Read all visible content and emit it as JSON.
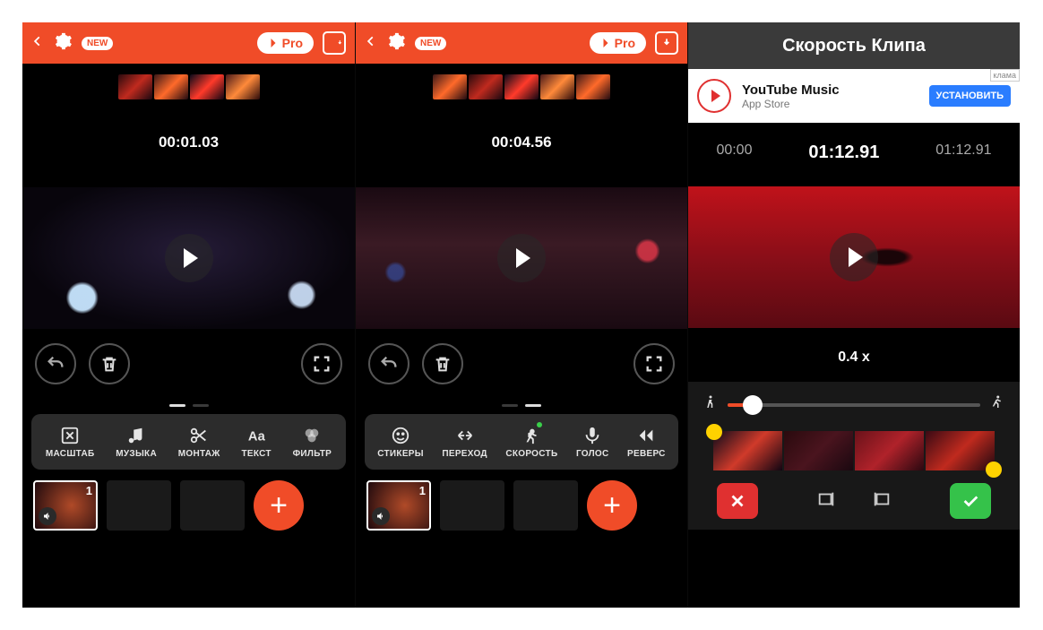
{
  "panel1": {
    "new_badge": "NEW",
    "pro_label": "Pro",
    "timecode": "00:01.03",
    "tools": {
      "scale": "МАСШТАБ",
      "music": "МУЗЫКА",
      "montage": "МОНТАЖ",
      "text": "ТЕКСТ",
      "filter": "ФИЛЬТР"
    },
    "clip_number": "1"
  },
  "panel2": {
    "new_badge": "NEW",
    "pro_label": "Pro",
    "timecode": "00:04.56",
    "tools": {
      "stickers": "СТИКЕРЫ",
      "transition": "ПЕРЕХОД",
      "speed": "СКОРОСТЬ",
      "voice": "ГОЛОС",
      "reverse": "РЕВЕРС"
    },
    "clip_number": "1"
  },
  "panel3": {
    "title": "Скорость Клипа",
    "ad": {
      "title": "YouTube Music",
      "subtitle": "App Store",
      "button": "УСТАНОВИТЬ",
      "badge": "клама"
    },
    "times": {
      "start": "00:00",
      "main": "01:12.91",
      "end": "01:12.91"
    },
    "speed_value": "0.4 x"
  }
}
